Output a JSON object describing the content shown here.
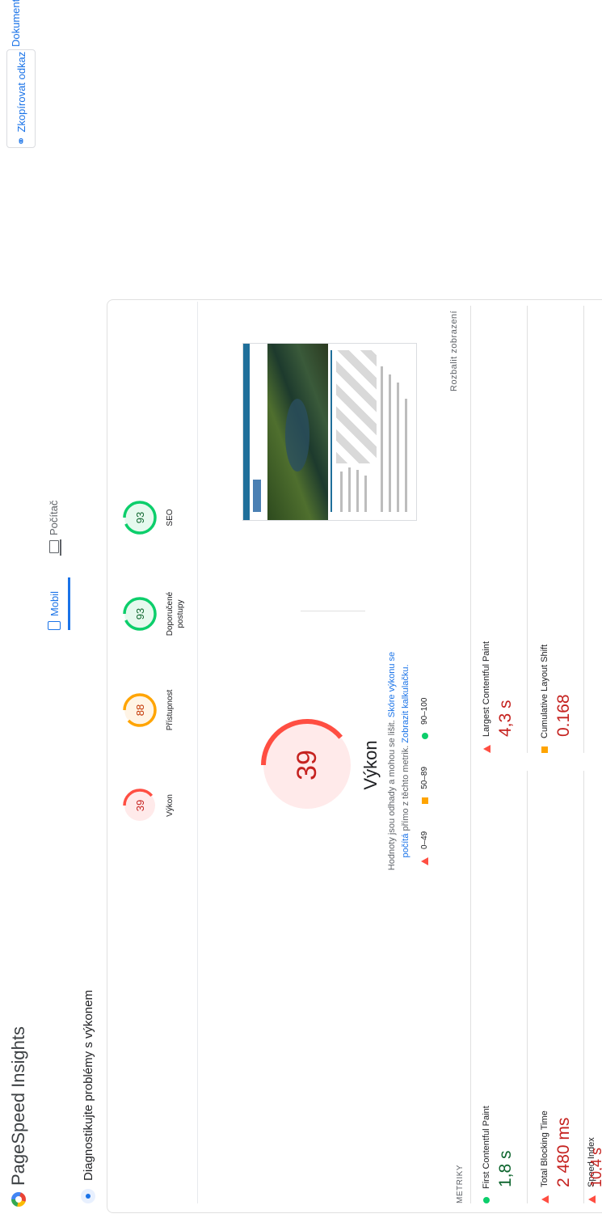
{
  "header": {
    "app_name": "PageSpeed Insights",
    "copy_link_label": "Zkopírovat odkaz",
    "docs_label": "Dokumenty"
  },
  "diagnose": {
    "title": "Diagnostikujte problémy s výkonem"
  },
  "device_tabs": [
    {
      "label": "Mobil",
      "selected": true
    },
    {
      "label": "Počítač",
      "selected": false
    }
  ],
  "categories": [
    {
      "label": "Výkon",
      "score": "39",
      "score_value": 39,
      "status": "poor"
    },
    {
      "label": "Přístupnost",
      "score": "88",
      "score_value": 88,
      "status": "average"
    },
    {
      "label": "Doporučené postupy",
      "score": "93",
      "score_value": 93,
      "status": "good"
    },
    {
      "label": "SEO",
      "score": "93",
      "score_value": 93,
      "status": "good"
    }
  ],
  "performance": {
    "score": "39",
    "score_value": 39,
    "title": "Výkon",
    "note_text": "Hodnoty jsou odhady a mohou se lišit. ",
    "note_link1": "Skóre výkonu se počítá",
    "note_mid": " přímo z těchto metrik. ",
    "note_link2": "Zobrazit kalkulačku."
  },
  "legend": [
    {
      "range": "0–49",
      "icon": "red-triangle"
    },
    {
      "range": "50–89",
      "icon": "orange-square"
    },
    {
      "range": "90–100",
      "icon": "green-circle"
    }
  ],
  "expand_view": "Rozbalit zobrazení",
  "metrics": {
    "title": "METRIKY",
    "items": [
      {
        "label": "First Contentful Paint",
        "value": "1,8 s",
        "status": "good"
      },
      {
        "label": "Largest Contentful Paint",
        "value": "4,3 s",
        "status": "poor"
      },
      {
        "label": "Total Blocking Time",
        "value": "2 480 ms",
        "status": "poor"
      },
      {
        "label": "Cumulative Layout Shift",
        "value": "0.168",
        "status": "average"
      },
      {
        "label": "Speed Index",
        "value": "10,4 s",
        "status": "poor"
      }
    ]
  },
  "colors": {
    "poor": "#ff4e42",
    "average": "#ffa400",
    "good": "#0cce6b",
    "accent": "#1a73e8"
  }
}
